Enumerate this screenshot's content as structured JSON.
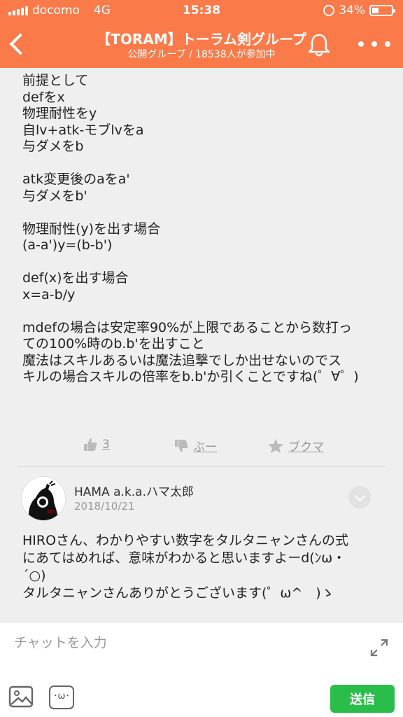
{
  "status_bar": {
    "carrier": "docomo",
    "network": "4G",
    "time": "15:38",
    "battery": "34%"
  },
  "header": {
    "title": "【TORAM】トーラム剣グループ",
    "subtitle": "公開グループ / 18538人が参加中",
    "bell_icon": "bell-icon",
    "more_icon": "more-icon"
  },
  "post": {
    "lines": [
      "前提として",
      "defをx",
      "物理耐性をy",
      "自lv+atk-モブlvをa",
      "与ダメをb",
      "",
      "atk変更後のaをa'",
      "与ダメをb'",
      "",
      "物理耐性(y)を出す場合",
      "(a-a')y=(b-b')",
      "",
      "def(x)を出す場合",
      "x=a-b/y",
      "",
      "mdefの場合は安定率90%が上限であることから数打っ",
      "ての100%時のb.b'を出すこと",
      "魔法はスキルあるいは魔法追撃でしか出せないのでス",
      "キルの場合スキルの倍率をb.b'か引くことですね(゜∀゜)"
    ]
  },
  "actions": {
    "like_count": "3",
    "boo_label": "ぶー",
    "bookmark_label": "ブクマ"
  },
  "comment": {
    "author": "HAMA a.k.a.ハマ太郎",
    "date": "2018/10/21",
    "lines": [
      "HIROさん、わかりやすい数字をタルタニャンさんの式",
      "にあてはめれば、意味がわかると思いますよーd(ﾝω・",
      "´○)",
      "タルタニャンさんありがとうございます(゜ω^　)ゝ"
    ]
  },
  "input_bar": {
    "placeholder": "チャットを入力",
    "send_label": "送信"
  },
  "colors": {
    "header": "#fb7a4a",
    "send": "#2bbd4a"
  }
}
